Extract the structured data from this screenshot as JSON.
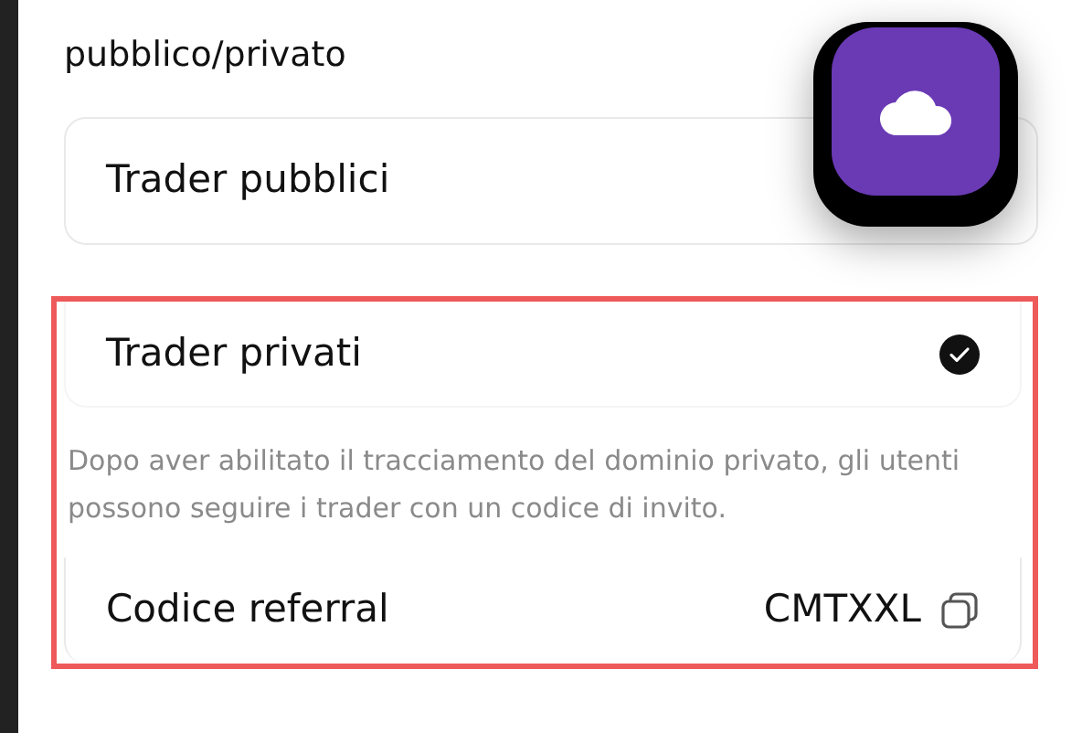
{
  "section_title": "pubblico/privato",
  "options": [
    {
      "label": "Trader pubblici",
      "selected": false
    },
    {
      "label": "Trader privati",
      "selected": true
    }
  ],
  "description": "Dopo aver abilitato il tracciamento del dominio privato, gli utenti possono seguire i trader con un codice di invito.",
  "referral": {
    "label": "Codice referral",
    "value": "CMTXXL"
  }
}
